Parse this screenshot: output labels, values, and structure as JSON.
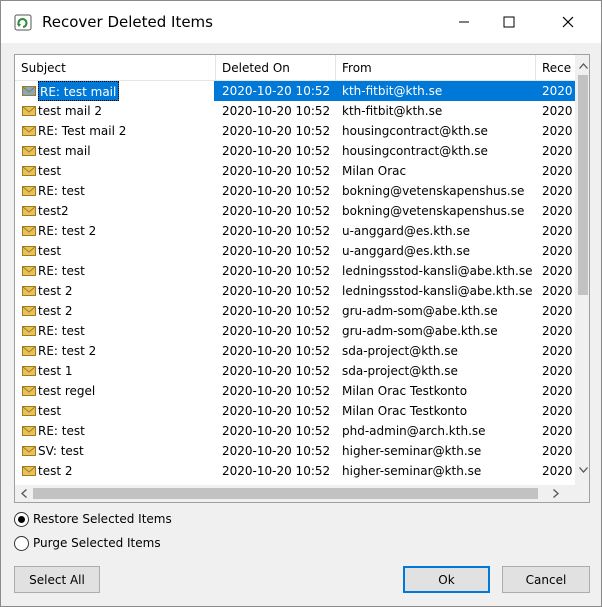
{
  "window": {
    "title": "Recover Deleted Items",
    "icons": {
      "app": "recover-items-icon",
      "minimize": "minimize-icon",
      "maximize": "maximize-icon",
      "close": "close-icon"
    }
  },
  "columns": [
    "Subject",
    "Deleted On",
    "From",
    "Rece"
  ],
  "rows": [
    {
      "subject": "RE: test mail",
      "deleted_on": "2020-10-20 10:52",
      "from": "kth-fitbit@kth.se",
      "received": "2020",
      "selected": true
    },
    {
      "subject": "test mail 2",
      "deleted_on": "2020-10-20 10:52",
      "from": "kth-fitbit@kth.se",
      "received": "2020"
    },
    {
      "subject": "RE: Test mail 2",
      "deleted_on": "2020-10-20 10:52",
      "from": "housingcontract@kth.se",
      "received": "2020"
    },
    {
      "subject": "test mail",
      "deleted_on": "2020-10-20 10:52",
      "from": "housingcontract@kth.se",
      "received": "2020"
    },
    {
      "subject": "test",
      "deleted_on": "2020-10-20 10:52",
      "from": "Milan Orac",
      "received": "2020"
    },
    {
      "subject": "RE: test",
      "deleted_on": "2020-10-20 10:52",
      "from": "bokning@vetenskapenshus.se",
      "received": "2020"
    },
    {
      "subject": "test2",
      "deleted_on": "2020-10-20 10:52",
      "from": "bokning@vetenskapenshus.se",
      "received": "2020"
    },
    {
      "subject": "RE: test 2",
      "deleted_on": "2020-10-20 10:52",
      "from": "u-anggard@es.kth.se",
      "received": "2020"
    },
    {
      "subject": "test",
      "deleted_on": "2020-10-20 10:52",
      "from": "u-anggard@es.kth.se",
      "received": "2020"
    },
    {
      "subject": "RE: test",
      "deleted_on": "2020-10-20 10:52",
      "from": "ledningsstod-kansli@abe.kth.se",
      "received": "2020"
    },
    {
      "subject": "test 2",
      "deleted_on": "2020-10-20 10:52",
      "from": "ledningsstod-kansli@abe.kth.se",
      "received": "2020"
    },
    {
      "subject": "test 2",
      "deleted_on": "2020-10-20 10:52",
      "from": "gru-adm-som@abe.kth.se",
      "received": "2020"
    },
    {
      "subject": "RE: test",
      "deleted_on": "2020-10-20 10:52",
      "from": "gru-adm-som@abe.kth.se",
      "received": "2020"
    },
    {
      "subject": "RE: test 2",
      "deleted_on": "2020-10-20 10:52",
      "from": "sda-project@kth.se",
      "received": "2020"
    },
    {
      "subject": "test 1",
      "deleted_on": "2020-10-20 10:52",
      "from": "sda-project@kth.se",
      "received": "2020"
    },
    {
      "subject": "test regel",
      "deleted_on": "2020-10-20 10:52",
      "from": "Milan Orac Testkonto",
      "received": "2020"
    },
    {
      "subject": "test",
      "deleted_on": "2020-10-20 10:52",
      "from": "Milan Orac Testkonto",
      "received": "2020"
    },
    {
      "subject": "RE: test",
      "deleted_on": "2020-10-20 10:52",
      "from": "phd-admin@arch.kth.se",
      "received": "2020"
    },
    {
      "subject": "SV: test",
      "deleted_on": "2020-10-20 10:52",
      "from": "higher-seminar@kth.se",
      "received": "2020"
    },
    {
      "subject": "test 2",
      "deleted_on": "2020-10-20 10:52",
      "from": "higher-seminar@kth.se",
      "received": "2020"
    }
  ],
  "options": {
    "restore_label": "Restore Selected Items",
    "purge_label": "Purge Selected Items",
    "selected": "restore"
  },
  "buttons": {
    "select_all": "Select All",
    "ok": "Ok",
    "cancel": "Cancel"
  },
  "colors": {
    "selection": "#0078d7",
    "envelope": "#e8c15a"
  }
}
